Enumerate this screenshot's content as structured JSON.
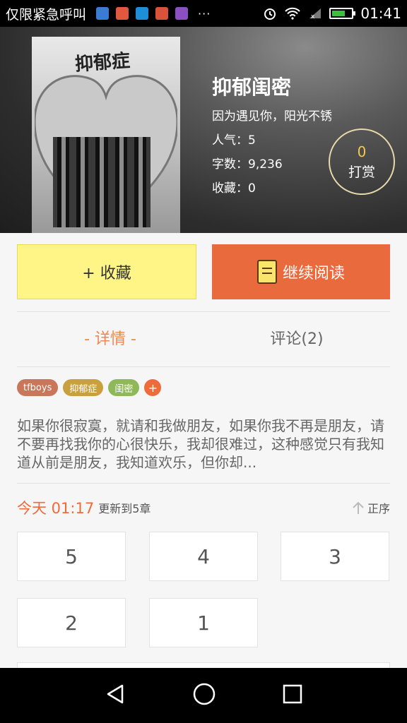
{
  "status_bar": {
    "carrier": "仅限紧急呼叫",
    "overflow_dots": "···",
    "time": "01:41",
    "notification_icons": [
      {
        "name": "k-app-icon",
        "color": "#3a7bd5"
      },
      {
        "name": "mail-icon",
        "color": "#e2583e"
      },
      {
        "name": "weather-icon",
        "color": "#1f8ed8"
      },
      {
        "name": "app-red-icon",
        "color": "#d9533a"
      },
      {
        "name": "gallery-icon",
        "color": "#8a4fc1"
      }
    ]
  },
  "book": {
    "cover_title": "抑郁症",
    "title": "抑郁闺密",
    "subtitle": "因为遇见你，阳光不锈",
    "popularity_label": "人气：",
    "popularity": "5",
    "words_label": "字数：",
    "words": "9,236",
    "favorites_label": "收藏：",
    "favorites": "0",
    "reward_count": "0",
    "reward_label": "打赏"
  },
  "actions": {
    "favorite_label": "+ 收藏",
    "continue_label": "继续阅读"
  },
  "tabs": {
    "detail": "- 详情 -",
    "comments": "评论(2)"
  },
  "tags": [
    {
      "label": "tfboys",
      "color": "#c9775a"
    },
    {
      "label": "抑郁症",
      "color": "#c8a040"
    },
    {
      "label": "闺密",
      "color": "#8fb85a"
    }
  ],
  "tag_add": "+",
  "summary": "如果你很寂寞，就请和我做朋友，如果你我不再是朋友，请不要再找我你的心很快乐，我却很难过，这种感觉只有我知道从前是朋友，我知道欢乐，但你却...",
  "update": {
    "time": "今天 01:17",
    "text": "更新到5章",
    "sort_label": "正序"
  },
  "chapters": [
    "5",
    "4",
    "3",
    "2",
    "1"
  ],
  "colors": {
    "accent": "#ee6b3c",
    "favorite_button": "#fef586",
    "read_button": "#e96a3c"
  }
}
